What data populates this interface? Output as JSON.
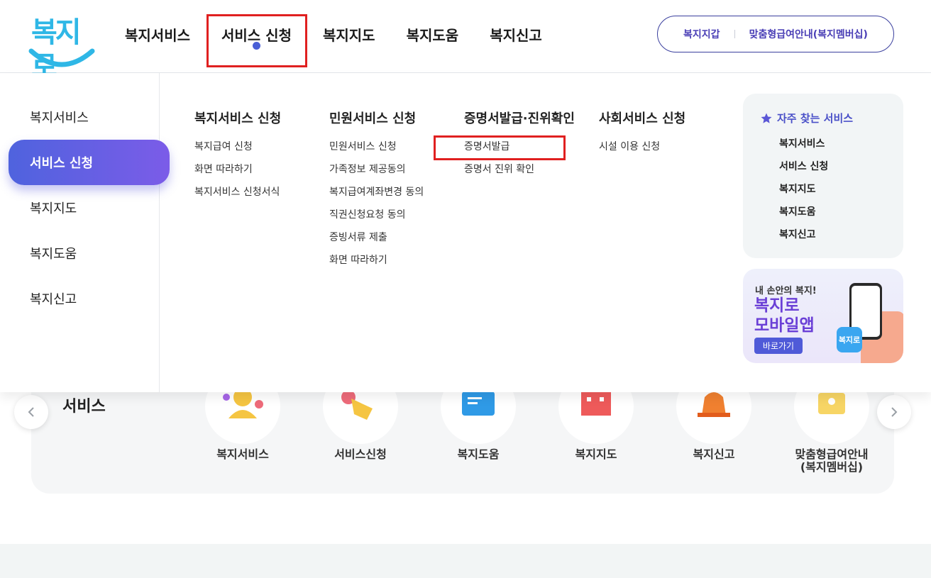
{
  "header": {
    "logo_text": "복지로",
    "gnb": [
      {
        "label": "복지서비스"
      },
      {
        "label": "서비스 신청",
        "active": true
      },
      {
        "label": "복지지도"
      },
      {
        "label": "복지도움"
      },
      {
        "label": "복지신고"
      }
    ],
    "util_links": [
      "복지지갑",
      "맞춤형급여안내(복지멤버십)"
    ]
  },
  "mega_menu": {
    "side": [
      "복지서비스",
      "서비스 신청",
      "복지지도",
      "복지도움",
      "복지신고"
    ],
    "columns": [
      {
        "title": "복지서비스 신청",
        "links": [
          "복지급여 신청",
          "화면 따라하기",
          "복지서비스 신청서식"
        ]
      },
      {
        "title": "민원서비스 신청",
        "links": [
          "민원서비스 신청",
          "가족정보 제공동의",
          "복지급여계좌변경 동의",
          "직권신청요청 동의",
          "증빙서류 제출",
          "화면 따라하기"
        ]
      },
      {
        "title": "증명서발급·진위확인",
        "links": [
          "증명서발급",
          "증명서 진위 확인"
        ]
      },
      {
        "title": "사회서비스 신청",
        "links": [
          "시설 이용 신청"
        ]
      }
    ],
    "favorites": {
      "title": "자주 찾는 서비스",
      "links": [
        "복지서비스",
        "서비스 신청",
        "복지지도",
        "복지도움",
        "복지신고"
      ]
    },
    "banner": {
      "small": "내 손안의 복지!",
      "big_line1": "복지로",
      "big_line2": "모바일앱",
      "button": "바로가기",
      "app_icon_text": "복지로"
    }
  },
  "quick_services": {
    "title": "서비스",
    "items": [
      {
        "label": "복지서비스"
      },
      {
        "label": "서비스신청"
      },
      {
        "label": "복지도움"
      },
      {
        "label": "복지지도"
      },
      {
        "label": "복지신고"
      },
      {
        "label_line1": "맞춤형급여안내",
        "label_line2": "(복지멤버십)"
      }
    ]
  },
  "colors": {
    "accent": "#4f63de",
    "accent_end": "#7b5ce8",
    "highlight": "#e02020",
    "logo": "#2fb7e6"
  }
}
